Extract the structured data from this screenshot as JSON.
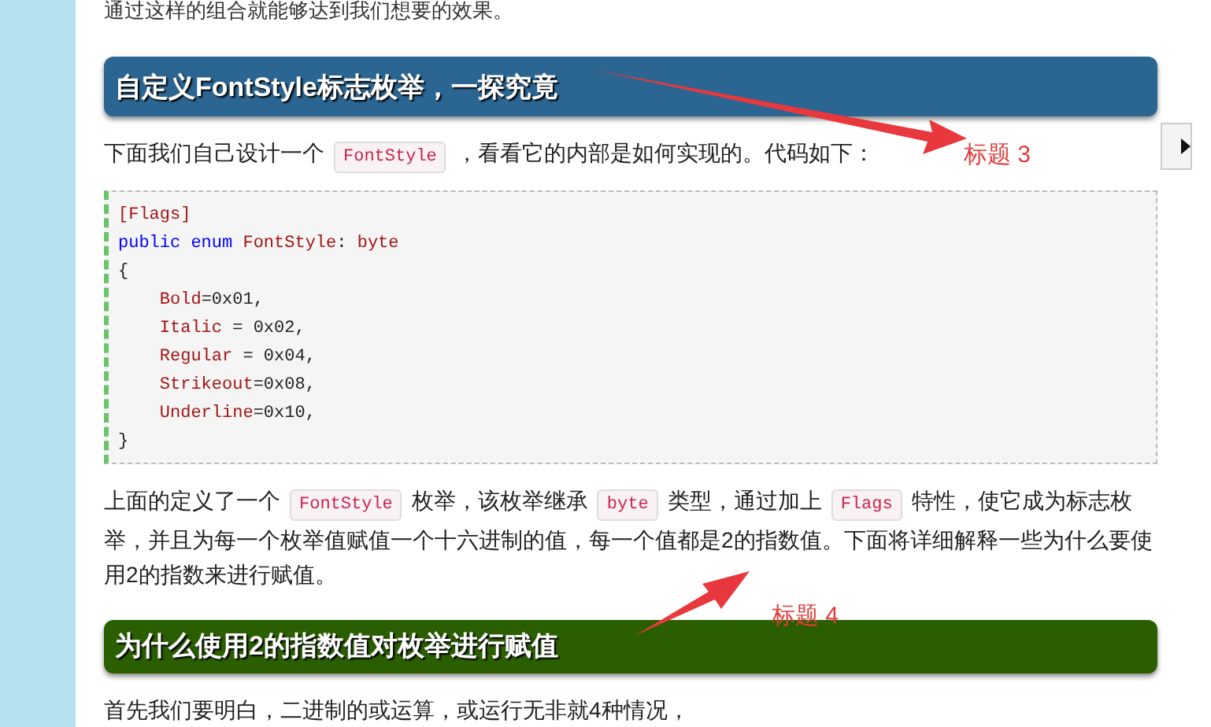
{
  "intro_text": "通过这样的组合就能够达到我们想要的效果。",
  "sections": [
    {
      "kind": "heading",
      "color": "#2b6592",
      "text": "自定义FontStyle标志枚举，一探究竟"
    },
    {
      "kind": "paragraph",
      "segments": [
        {
          "kind": "text",
          "text": "下面我们自己设计一个"
        },
        {
          "kind": "code",
          "text": "FontStyle"
        },
        {
          "kind": "text",
          "text": "，看看它的内部是如何实现的。代码如下："
        }
      ]
    },
    {
      "kind": "codeblock",
      "lines": [
        [
          {
            "kind": "type",
            "text": "[Flags]"
          }
        ],
        [
          {
            "kind": "keyword",
            "text": "public enum "
          },
          {
            "kind": "type",
            "text": "FontStyle"
          },
          {
            "kind": "plain",
            "text": ": "
          },
          {
            "kind": "type",
            "text": "byte"
          }
        ],
        [
          {
            "kind": "plain",
            "text": "{"
          }
        ],
        [
          {
            "kind": "type",
            "text": "    Bold"
          },
          {
            "kind": "plain",
            "text": "=0x01,"
          }
        ],
        [
          {
            "kind": "type",
            "text": "    Italic"
          },
          {
            "kind": "plain",
            "text": " = 0x02,"
          }
        ],
        [
          {
            "kind": "type",
            "text": "    Regular"
          },
          {
            "kind": "plain",
            "text": " = 0x04,"
          }
        ],
        [
          {
            "kind": "type",
            "text": "    Strikeout"
          },
          {
            "kind": "plain",
            "text": "=0x08,"
          }
        ],
        [
          {
            "kind": "type",
            "text": "    Underline"
          },
          {
            "kind": "plain",
            "text": "=0x10,"
          }
        ],
        [
          {
            "kind": "plain",
            "text": "}"
          }
        ]
      ]
    },
    {
      "kind": "paragraph",
      "segments": [
        {
          "kind": "text",
          "text": "上面的定义了一个"
        },
        {
          "kind": "code",
          "text": "FontStyle"
        },
        {
          "kind": "text",
          "text": "枚举，该枚举继承"
        },
        {
          "kind": "code",
          "text": "byte"
        },
        {
          "kind": "text",
          "text": "类型，通过加上"
        },
        {
          "kind": "code",
          "text": "Flags"
        },
        {
          "kind": "text",
          "text": "特性，使它成为标志枚举，并且为每一个枚举值赋值一个十六进制的值，每一个值都是2的指数值。下面将详细解释一些为什么要使用2的指数来进行赋值。"
        }
      ]
    },
    {
      "kind": "heading",
      "color": "#2a5e00",
      "text": "为什么使用2的指数值对枚举进行赋值"
    },
    {
      "kind": "paragraph",
      "segments": [
        {
          "kind": "text",
          "text": "首先我们要明白，二进制的或运算，或运行无非就4种情况，"
        }
      ]
    }
  ],
  "annotations": [
    {
      "text": "标题 3"
    },
    {
      "text": "标题 4"
    }
  ]
}
